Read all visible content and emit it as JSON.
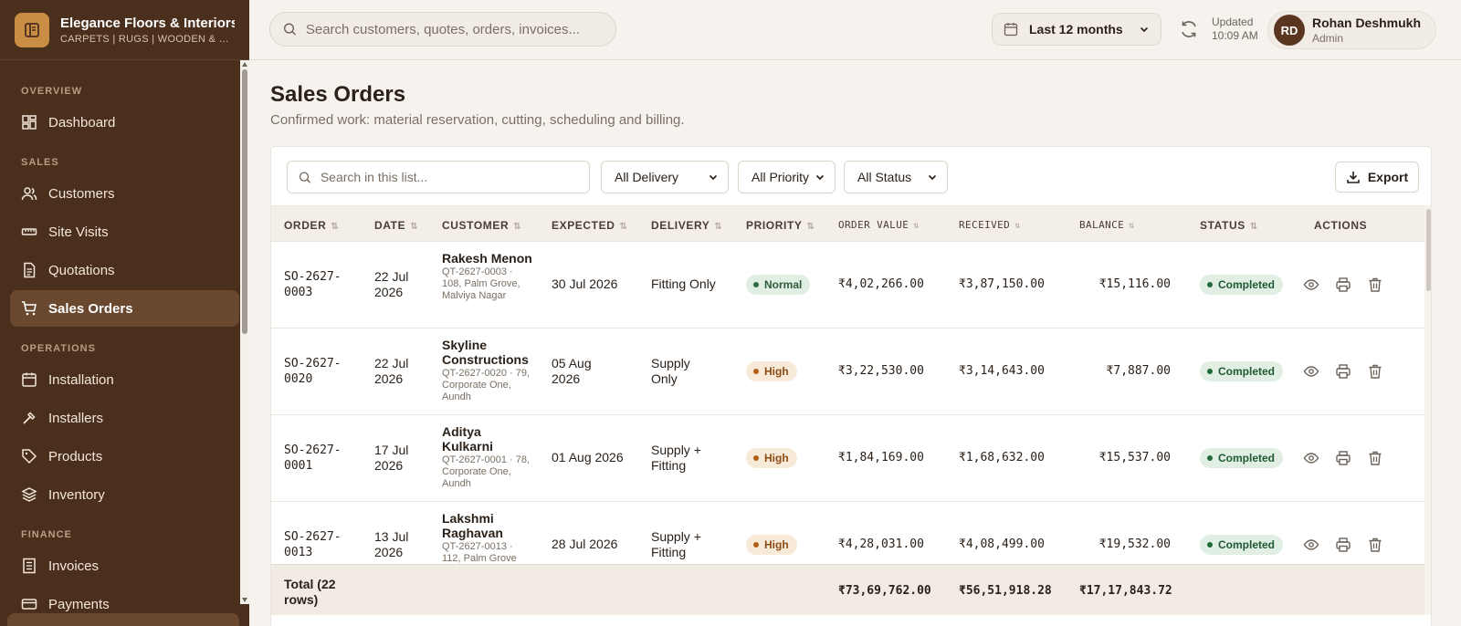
{
  "brand": {
    "name": "Elegance Floors & Interiors",
    "subtitle": "CARPETS | RUGS | WOODEN & VI..."
  },
  "sidebar": {
    "sections": [
      {
        "label": "OVERVIEW",
        "items": [
          {
            "label": "Dashboard",
            "icon": "dashboard-icon"
          }
        ]
      },
      {
        "label": "SALES",
        "items": [
          {
            "label": "Customers",
            "icon": "users-icon"
          },
          {
            "label": "Site Visits",
            "icon": "ruler-icon"
          },
          {
            "label": "Quotations",
            "icon": "document-icon"
          },
          {
            "label": "Sales Orders",
            "icon": "cart-icon",
            "active": true
          }
        ]
      },
      {
        "label": "OPERATIONS",
        "items": [
          {
            "label": "Installation",
            "icon": "calendar-icon"
          },
          {
            "label": "Installers",
            "icon": "hammer-icon"
          },
          {
            "label": "Products",
            "icon": "tag-icon"
          },
          {
            "label": "Inventory",
            "icon": "layers-icon"
          }
        ]
      },
      {
        "label": "FINANCE",
        "items": [
          {
            "label": "Invoices",
            "icon": "receipt-icon"
          },
          {
            "label": "Payments",
            "icon": "card-icon"
          }
        ]
      }
    ]
  },
  "topbar": {
    "search_placeholder": "Search customers, quotes, orders, invoices...",
    "date_range": "Last 12 months",
    "updated_label": "Updated",
    "updated_time": "10:09 AM",
    "user": {
      "initials": "RD",
      "name": "Rohan Deshmukh",
      "role": "Admin"
    }
  },
  "page": {
    "title": "Sales Orders",
    "subtitle": "Confirmed work: material reservation, cutting, scheduling and billing."
  },
  "filters": {
    "search_placeholder": "Search in this list...",
    "delivery": "All Delivery",
    "priority": "All Priority",
    "status": "All Status",
    "export_label": "Export"
  },
  "table": {
    "columns": {
      "order": "ORDER",
      "date": "DATE",
      "customer": "CUSTOMER",
      "expected": "EXPECTED",
      "delivery": "DELIVERY",
      "priority": "PRIORITY",
      "order_value": "ORDER VALUE",
      "received": "RECEIVED",
      "balance": "BALANCE",
      "status": "STATUS",
      "actions": "ACTIONS"
    },
    "rows": [
      {
        "order": "SO-2627-0003",
        "date": "22 Jul 2026",
        "customer": "Rakesh Menon",
        "quote": "QT-2627-0003 · 108, Palm Grove, Malviya Nagar",
        "expected": "30 Jul 2026",
        "delivery": "Fitting Only",
        "priority": "Normal",
        "order_value": "₹4,02,266.00",
        "received": "₹3,87,150.00",
        "balance": "₹15,116.00",
        "status": "Completed"
      },
      {
        "order": "SO-2627-0020",
        "date": "22 Jul 2026",
        "customer": "Skyline Constructions",
        "quote": "QT-2627-0020 · 79, Corporate One, Aundh",
        "expected": "05 Aug 2026",
        "delivery": "Supply Only",
        "priority": "High",
        "order_value": "₹3,22,530.00",
        "received": "₹3,14,643.00",
        "balance": "₹7,887.00",
        "status": "Completed"
      },
      {
        "order": "SO-2627-0001",
        "date": "17 Jul 2026",
        "customer": "Aditya Kulkarni",
        "quote": "QT-2627-0001 · 78, Corporate One, Aundh",
        "expected": "01 Aug 2026",
        "delivery": "Supply + Fitting",
        "priority": "High",
        "order_value": "₹1,84,169.00",
        "received": "₹1,68,632.00",
        "balance": "₹15,537.00",
        "status": "Completed"
      },
      {
        "order": "SO-2627-0013",
        "date": "13 Jul 2026",
        "customer": "Lakshmi Raghavan",
        "quote": "QT-2627-0013 · 112, Palm Grove",
        "expected": "28 Jul 2026",
        "delivery": "Supply + Fitting",
        "priority": "High",
        "order_value": "₹4,28,031.00",
        "received": "₹4,08,499.00",
        "balance": "₹19,532.00",
        "status": "Completed"
      }
    ],
    "total": {
      "label": "Total (22 rows)",
      "order_value": "₹73,69,762.00",
      "received": "₹56,51,918.28",
      "balance": "₹17,17,843.72"
    }
  },
  "colors": {
    "sidebar_bg": "#4a2f1d",
    "accent": "#c98d44",
    "page_bg": "#f6f3ee"
  }
}
